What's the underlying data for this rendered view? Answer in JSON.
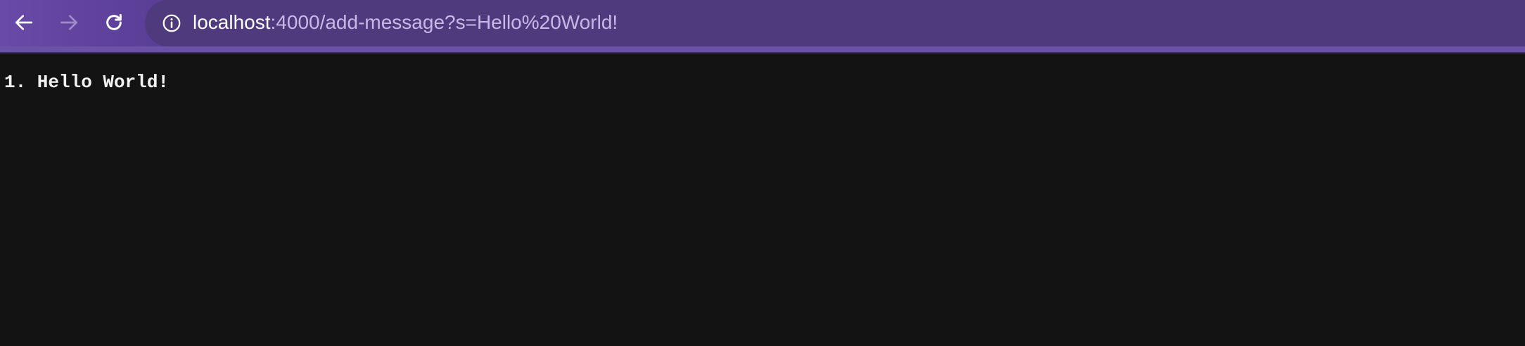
{
  "browser": {
    "address_bar": {
      "host": "localhost",
      "path": ":4000/add-message?s=Hello%20World!"
    },
    "icons": {
      "back": "back-arrow-icon",
      "forward": "forward-arrow-icon",
      "reload": "reload-icon",
      "site_info": "info-icon"
    },
    "colors": {
      "toolbar": "#533a82",
      "omnibox": "#4f3a7d",
      "page_background": "#131313",
      "text": "#f2f2f2"
    }
  },
  "page": {
    "messages": [
      {
        "text": "1. Hello World!"
      }
    ]
  }
}
